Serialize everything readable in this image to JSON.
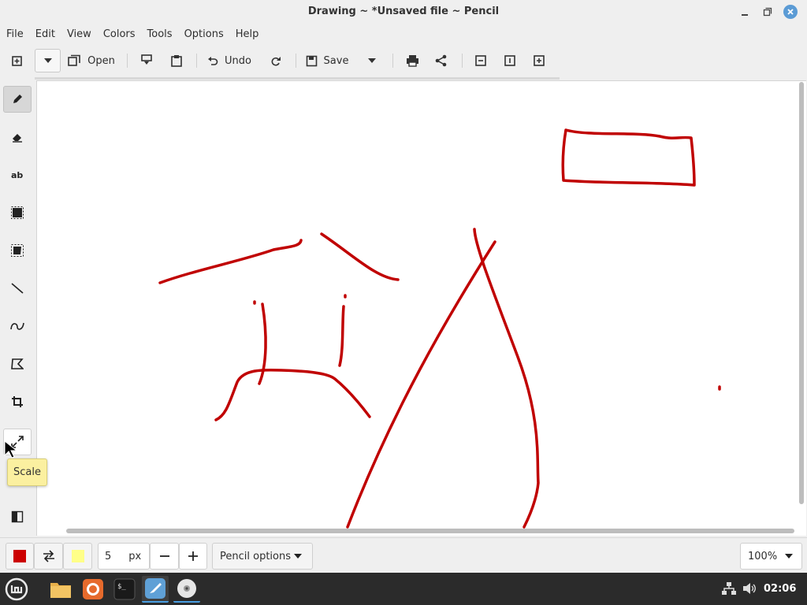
{
  "window": {
    "title": "Drawing ~ *Unsaved file ~ Pencil"
  },
  "menu": [
    "File",
    "Edit",
    "View",
    "Colors",
    "Tools",
    "Options",
    "Help"
  ],
  "toolbar": {
    "open_label": "Open",
    "undo_label": "Undo",
    "save_label": "Save"
  },
  "side_tools": [
    "pencil",
    "eraser",
    "text",
    "rectangle-selection",
    "free-selection",
    "line",
    "curve",
    "free-shape",
    "crop",
    "scale",
    "filters"
  ],
  "tooltip": {
    "text": "Scale"
  },
  "options_bar": {
    "main_color": "#cc0000",
    "secondary_color": "#ffff88",
    "size_value": "5",
    "size_unit": "px",
    "tool_options_label": "Pencil options",
    "zoom_label": "100%"
  },
  "drawing": {
    "stroke_color": "#c00000"
  },
  "taskbar": {
    "clock": "02:06",
    "apps": [
      "menu",
      "files",
      "firefox",
      "terminal",
      "drawing",
      "disc"
    ]
  }
}
